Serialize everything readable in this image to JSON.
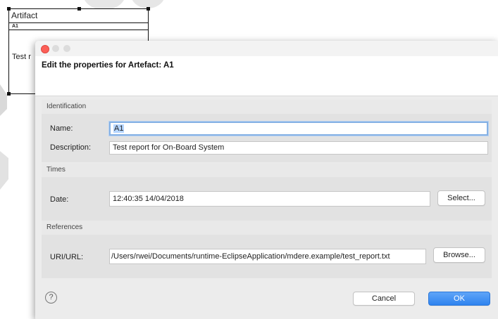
{
  "diagram": {
    "element_type": "Artifact",
    "element_id": "A1",
    "element_desc_fragment": "Test r"
  },
  "dialog": {
    "message": "Edit the properties for Artefact: A1",
    "identification": {
      "legend": "Identification",
      "name_label": "Name:",
      "name_value": "A1",
      "description_label": "Description:",
      "description_value": "Test report for On-Board System"
    },
    "times": {
      "legend": "Times",
      "date_label": "Date:",
      "date_value": "12:40:35 14/04/2018",
      "select_label": "Select..."
    },
    "references": {
      "legend": "References",
      "uri_label": "URI/URL:",
      "uri_value": "/Users/rwei/Documents/runtime-EclipseApplication/mdere.example/test_report.txt",
      "browse_label": "Browse..."
    },
    "help_icon": "?",
    "cancel_label": "Cancel",
    "ok_label": "OK"
  },
  "colors": {
    "ok_button": "#3a8df3",
    "focus_ring": "#85b1e4",
    "close_light": "#fc5f57"
  }
}
